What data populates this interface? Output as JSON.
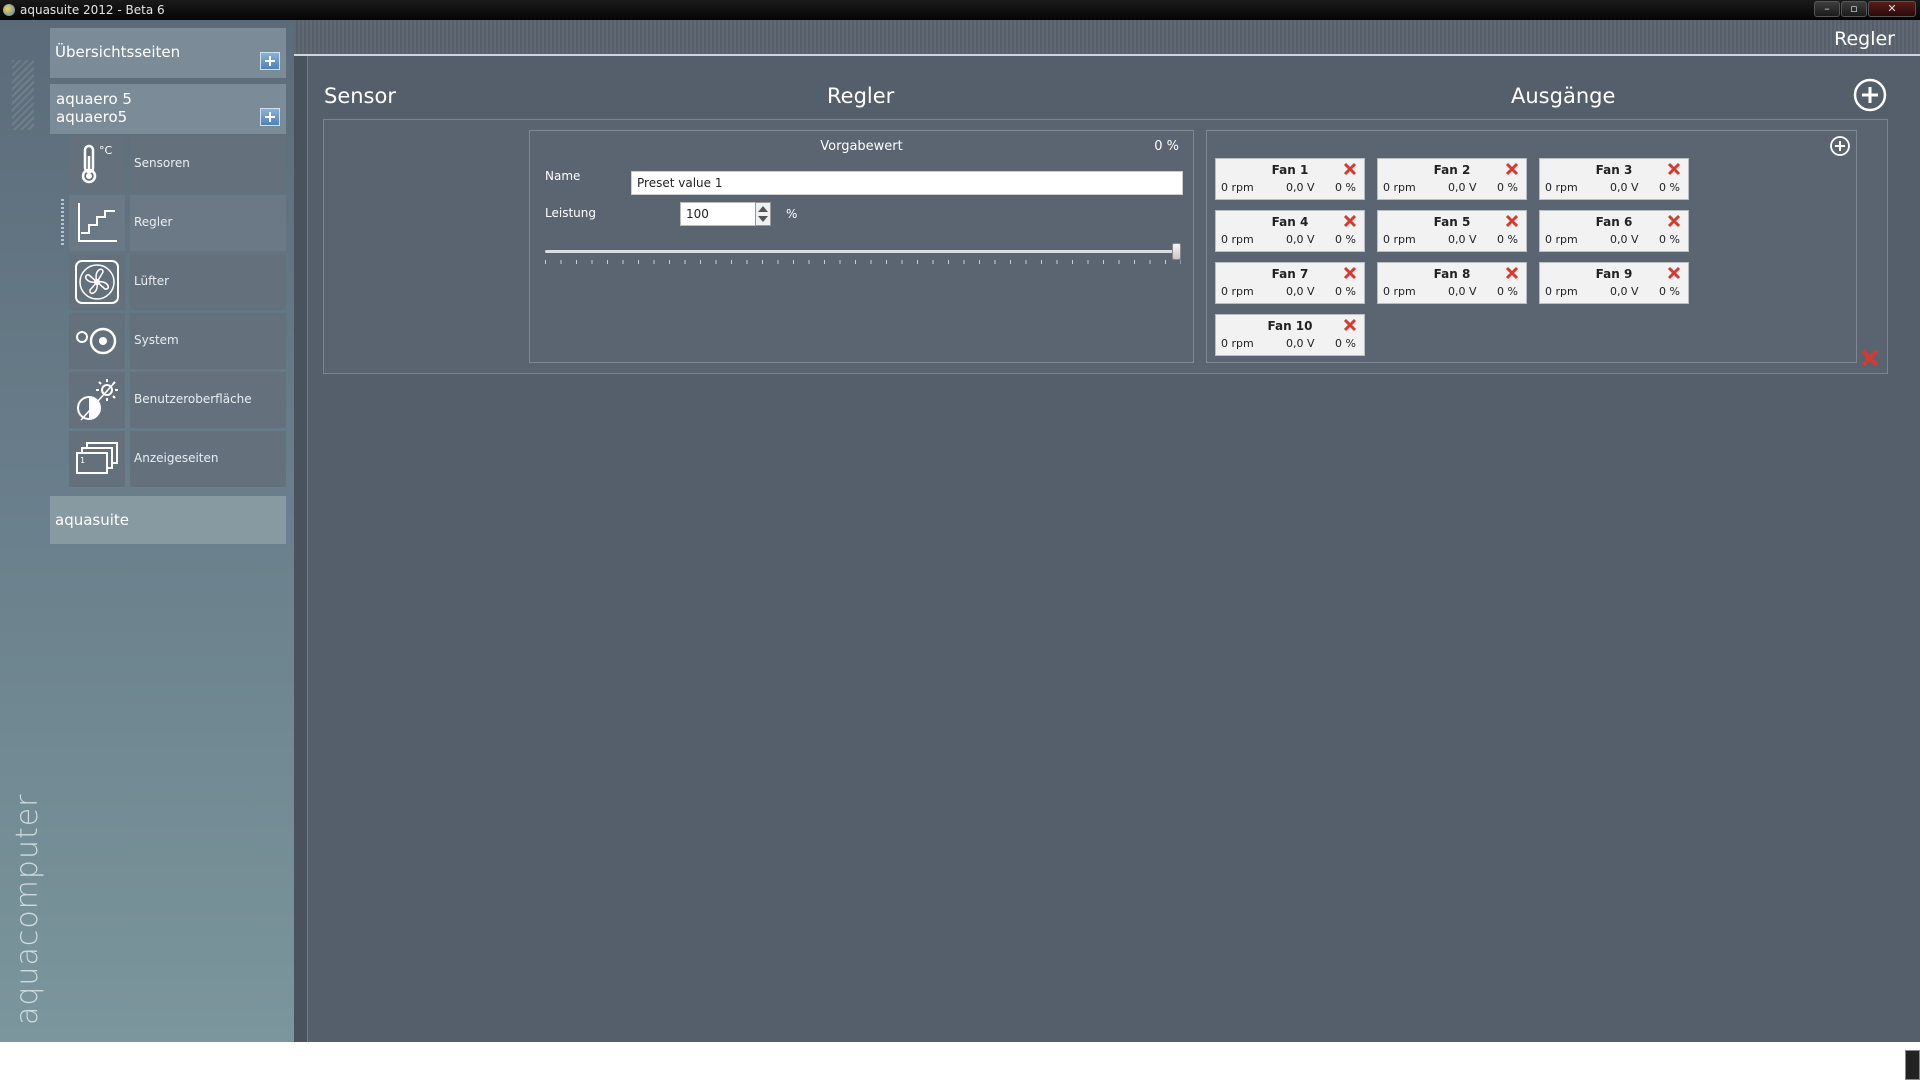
{
  "window": {
    "title": "aquasuite 2012 - Beta 6",
    "minimize": "–",
    "maximize": "▫",
    "close": "✕"
  },
  "sidebar": {
    "overview_label": "Übersichtsseiten",
    "device_line1": "aquaero 5",
    "device_line2": "aquaero5",
    "items": [
      {
        "label": "Sensoren",
        "icon": "thermometer-icon"
      },
      {
        "label": "Regler",
        "icon": "controller-curve-icon"
      },
      {
        "label": "Lüfter",
        "icon": "fan-icon"
      },
      {
        "label": "System",
        "icon": "system-gears-icon"
      },
      {
        "label": "Benutzeroberfläche",
        "icon": "brightness-contrast-icon"
      },
      {
        "label": "Anzeigeseiten",
        "icon": "display-pages-icon"
      }
    ],
    "aquasuite_label": "aquasuite",
    "brand": "aquacomputer"
  },
  "main": {
    "page_title": "Regler",
    "columns": {
      "sensor": "Sensor",
      "regler": "Regler",
      "outputs": "Ausgänge"
    },
    "preset": {
      "title": "Vorgabewert",
      "value": "0 %",
      "name_label": "Name",
      "name_value": "Preset value 1",
      "power_label": "Leistung",
      "power_value": "100",
      "power_unit": "%",
      "slider_fraction": 1.0
    },
    "fans": [
      {
        "name": "Fan 1",
        "rpm": "0 rpm",
        "voltage": "0,0 V",
        "percent": "0 %"
      },
      {
        "name": "Fan 2",
        "rpm": "0 rpm",
        "voltage": "0,0 V",
        "percent": "0 %"
      },
      {
        "name": "Fan 3",
        "rpm": "0 rpm",
        "voltage": "0,0 V",
        "percent": "0 %"
      },
      {
        "name": "Fan 4",
        "rpm": "0 rpm",
        "voltage": "0,0 V",
        "percent": "0 %"
      },
      {
        "name": "Fan 5",
        "rpm": "0 rpm",
        "voltage": "0,0 V",
        "percent": "0 %"
      },
      {
        "name": "Fan 6",
        "rpm": "0 rpm",
        "voltage": "0,0 V",
        "percent": "0 %"
      },
      {
        "name": "Fan 7",
        "rpm": "0 rpm",
        "voltage": "0,0 V",
        "percent": "0 %"
      },
      {
        "name": "Fan 8",
        "rpm": "0 rpm",
        "voltage": "0,0 V",
        "percent": "0 %"
      },
      {
        "name": "Fan 9",
        "rpm": "0 rpm",
        "voltage": "0,0 V",
        "percent": "0 %"
      },
      {
        "name": "Fan 10",
        "rpm": "0 rpm",
        "voltage": "0,0 V",
        "percent": "0 %"
      }
    ]
  },
  "colors": {
    "sidebar": "#6a808c",
    "main_bg": "#555f6b",
    "delete_red": "#d63a2f"
  }
}
